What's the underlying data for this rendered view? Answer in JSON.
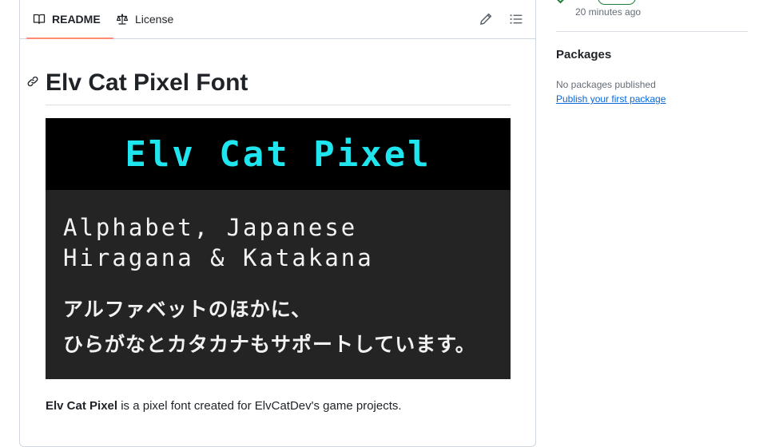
{
  "tabs": {
    "readme": {
      "label": "README",
      "icon": "book-icon"
    },
    "license": {
      "label": "License",
      "icon": "law-scale-icon"
    }
  },
  "toolbar": {
    "edit_icon": "pencil-icon",
    "toc_icon": "list-unordered-icon"
  },
  "readme": {
    "title": "Elv Cat Pixel Font",
    "banner": {
      "title": "Elv Cat Pixel",
      "line1": "Alphabet, Japanese",
      "line2": "Hiragana & Katakana",
      "jp_line1": "アルファベットのほかに、",
      "jp_line2": "ひらがなとカタカナもサポートしています。"
    },
    "description_bold": "Elv Cat Pixel",
    "description_rest": " is a pixel font created for ElvCatDev's game projects."
  },
  "sidebar": {
    "status_time": "20 minutes ago",
    "packages": {
      "heading": "Packages",
      "empty_text": "No packages published",
      "publish_link": "Publish your first package"
    }
  },
  "colors": {
    "accent_underline": "#fd8c73",
    "link": "#0969da",
    "banner_cyan": "#1fe5ee",
    "success": "#1a7f37"
  }
}
